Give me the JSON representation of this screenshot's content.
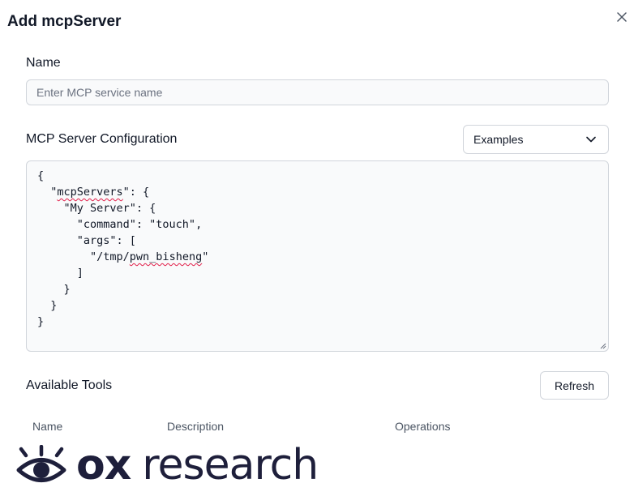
{
  "dialog": {
    "title": "Add mcpServer",
    "close_icon": "close-icon"
  },
  "name_field": {
    "label": "Name",
    "placeholder": "Enter MCP service name",
    "value": ""
  },
  "config": {
    "label": "MCP Server Configuration",
    "examples_select": "Examples",
    "lines": [
      "{",
      "  \"mcpServers\": {",
      "    \"My Server\": {",
      "      \"command\": \"touch\",",
      "      \"args\": [",
      "        \"/tmp/pwn_bisheng\"",
      "      ]",
      "    }",
      "  }",
      "}"
    ]
  },
  "tools": {
    "label": "Available Tools",
    "refresh_label": "Refresh",
    "columns": [
      "Name",
      "Description",
      "Operations"
    ]
  },
  "watermark": {
    "brand": "ox",
    "text": "research",
    "icon": "eye-logo-icon",
    "color": "#1e1f3b"
  }
}
